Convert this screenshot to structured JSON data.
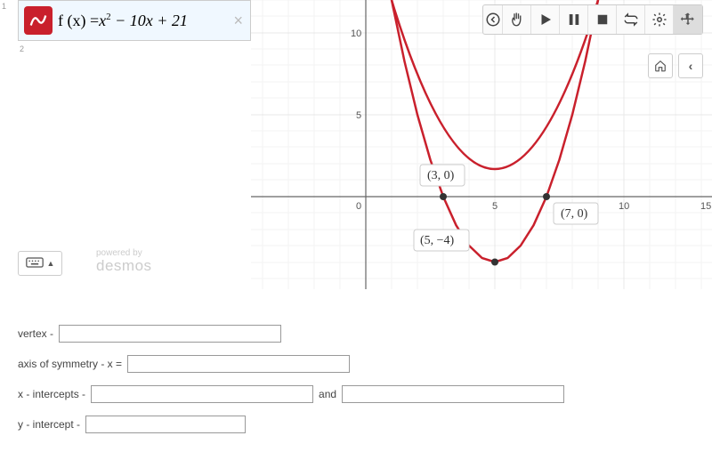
{
  "expression": {
    "row1_num": "1",
    "row2_num": "2",
    "formula_lhs": "f (x) =",
    "formula_rhs_a": "x",
    "formula_exp": "2",
    "formula_rhs_b": " − 10x + 21",
    "close": "×"
  },
  "powered": {
    "by": "powered by",
    "brand": "desmos"
  },
  "axis_ticks": {
    "y10": "10",
    "y5": "5",
    "x0": "0",
    "x5": "5",
    "x10": "10",
    "x15": "15"
  },
  "points": {
    "p1": "(3, 0)",
    "p2": "(7, 0)",
    "p3": "(5, −4)"
  },
  "form": {
    "vertex_label": "vertex -",
    "axis_label": "axis of symmetry - x =",
    "xint_label": "x - intercepts -",
    "and": "and",
    "yint_label": "y - intercept -",
    "vertex": "",
    "axis": "",
    "xi1": "",
    "xi2": "",
    "yi": ""
  },
  "chart_data": {
    "type": "line",
    "title": "",
    "xlabel": "",
    "ylabel": "",
    "xlim": [
      -2,
      16
    ],
    "ylim": [
      -5,
      12
    ],
    "series": [
      {
        "name": "f(x)=x^2-10x+21",
        "x": [
          1,
          1.5,
          2,
          2.5,
          3,
          3.5,
          4,
          4.5,
          5,
          5.5,
          6,
          6.5,
          7,
          7.5,
          8,
          8.5,
          9
        ],
        "y": [
          12,
          8.25,
          5,
          2.25,
          0,
          -1.75,
          -3,
          -3.75,
          -4,
          -3.75,
          -3,
          -1.75,
          0,
          2.25,
          5,
          8.25,
          12
        ]
      }
    ],
    "annotations": [
      {
        "x": 3,
        "y": 0,
        "text": "(3, 0)"
      },
      {
        "x": 7,
        "y": 0,
        "text": "(7, 0)"
      },
      {
        "x": 5,
        "y": -4,
        "text": "(5, −4)"
      }
    ]
  }
}
